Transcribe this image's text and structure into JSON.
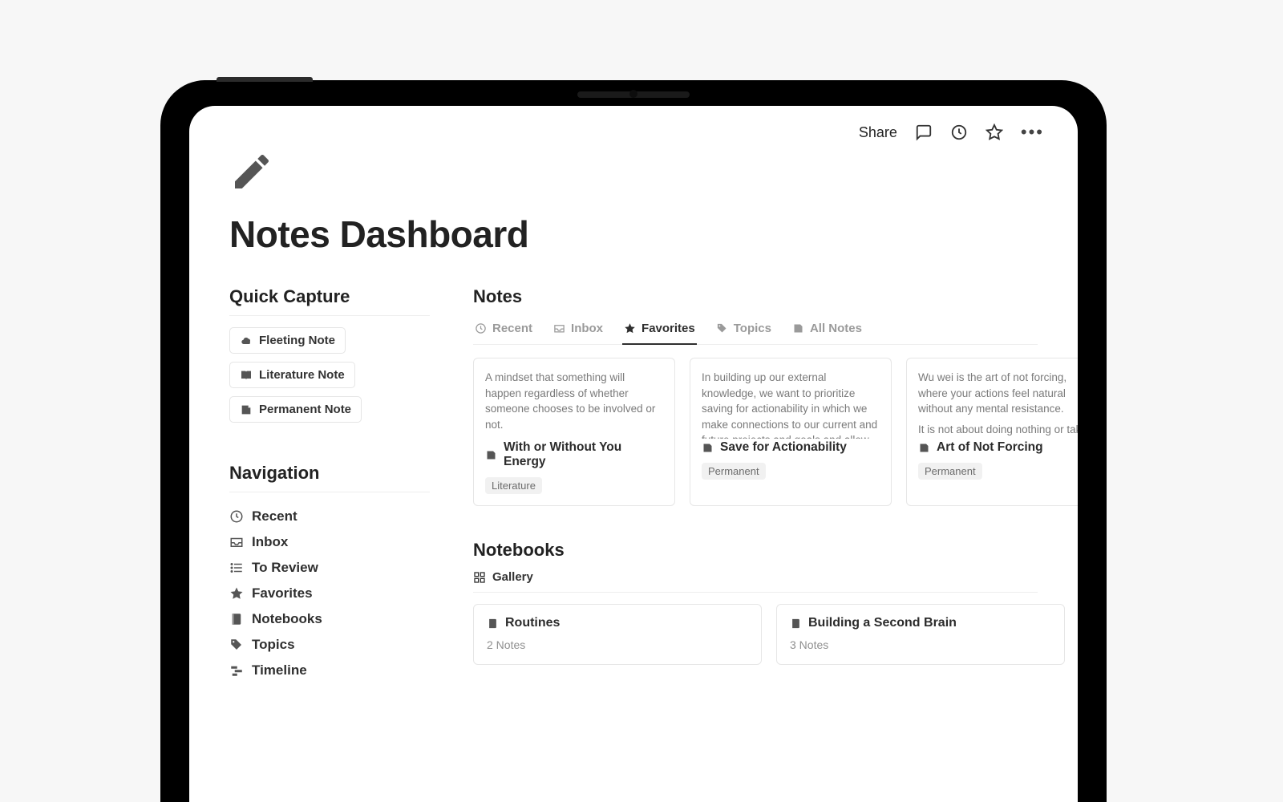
{
  "header": {
    "title": "Notes Dashboard",
    "share_label": "Share"
  },
  "quick_capture": {
    "heading": "Quick Capture",
    "items": [
      {
        "label": "Fleeting Note"
      },
      {
        "label": "Literature Note"
      },
      {
        "label": "Permanent Note"
      }
    ]
  },
  "navigation": {
    "heading": "Navigation",
    "items": [
      {
        "label": "Recent"
      },
      {
        "label": "Inbox"
      },
      {
        "label": "To Review"
      },
      {
        "label": "Favorites"
      },
      {
        "label": "Notebooks"
      },
      {
        "label": "Topics"
      },
      {
        "label": "Timeline"
      }
    ]
  },
  "notes": {
    "heading": "Notes",
    "tabs": [
      {
        "label": "Recent"
      },
      {
        "label": "Inbox"
      },
      {
        "label": "Favorites"
      },
      {
        "label": "Topics"
      },
      {
        "label": "All Notes"
      }
    ],
    "active_tab": "Favorites",
    "cards": [
      {
        "excerpt1": "A mindset that something will happen regardless of whether someone chooses to be involved or not.",
        "excerpt2": "",
        "title": "With or Without You Energy",
        "tag": "Literature"
      },
      {
        "excerpt1": "In building up our external knowledge, we want to prioritize saving for actionability in which we make connections to our current and future projects and goals and allow for our",
        "excerpt2": "",
        "title": "Save for Actionability",
        "tag": "Permanent"
      },
      {
        "excerpt1": "Wu wei is the art of not forcing, where your actions feel natural without any mental resistance.",
        "excerpt2": "It is not about doing nothing or taking the easy way out, it requires",
        "title": "Art of Not Forcing",
        "tag": "Permanent"
      }
    ]
  },
  "notebooks": {
    "heading": "Notebooks",
    "view_label": "Gallery",
    "cards": [
      {
        "title": "Routines",
        "sub": "2 Notes"
      },
      {
        "title": "Building a Second Brain",
        "sub": "3 Notes"
      }
    ]
  }
}
